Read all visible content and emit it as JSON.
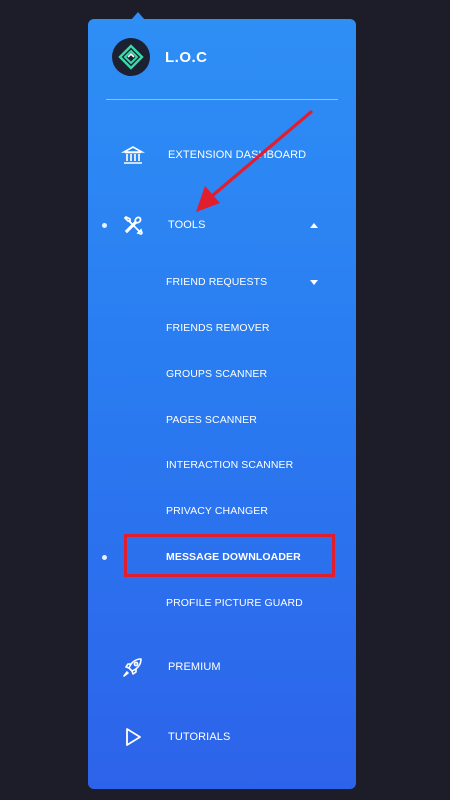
{
  "brand": {
    "name": "L.O.C",
    "logo_icon": "loc-logo-icon"
  },
  "menu": {
    "dashboard": {
      "label": "EXTENSION DASHBOARD",
      "icon": "bank-icon"
    },
    "tools": {
      "label": "TOOLS",
      "icon": "tools-icon",
      "expanded": true
    },
    "premium": {
      "label": "PREMIUM",
      "icon": "rocket-icon"
    },
    "tutorials": {
      "label": "TUTORIALS",
      "icon": "play-icon"
    }
  },
  "tools_submenu": {
    "items": [
      {
        "label": "FRIEND REQUESTS",
        "has_dropdown": true
      },
      {
        "label": "FRIENDS REMOVER"
      },
      {
        "label": "GROUPS SCANNER"
      },
      {
        "label": "PAGES SCANNER"
      },
      {
        "label": "INTERACTION SCANNER"
      },
      {
        "label": "PRIVACY CHANGER"
      },
      {
        "label": "MESSAGE DOWNLOADER",
        "active": true
      },
      {
        "label": "PROFILE PICTURE GUARD"
      }
    ]
  },
  "annotations": {
    "arrow_color": "#e11d2e",
    "highlight_color": "#e11d2e"
  },
  "colors": {
    "panel_top": "#2e8ff5",
    "panel_bottom": "#2d63ea",
    "background": "#1c1d28",
    "logo_accent": "#3ad9a8"
  }
}
